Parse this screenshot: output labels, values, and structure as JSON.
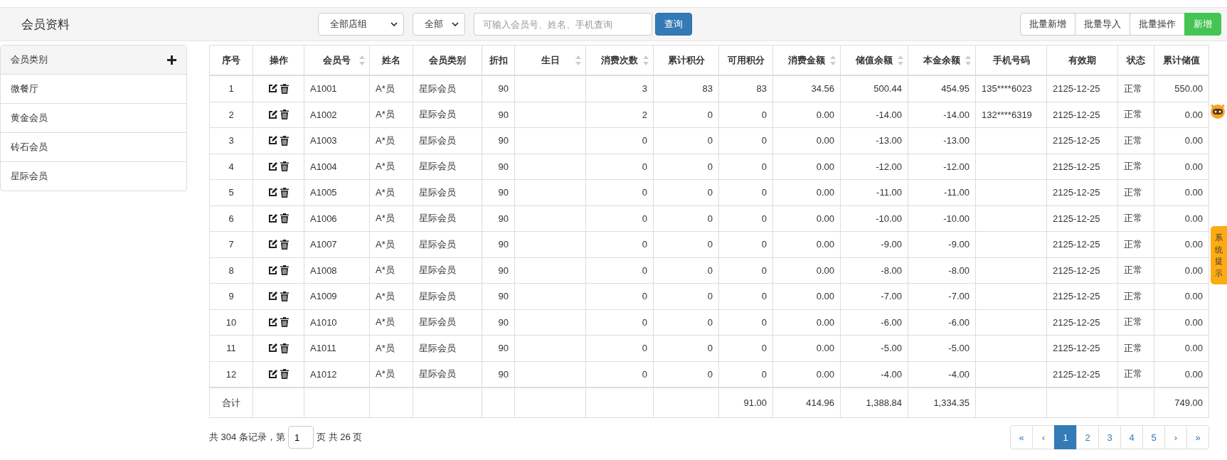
{
  "header": {
    "title": "会员资料",
    "store_group_select": "全部店组",
    "scope_select": "全部",
    "search": {
      "placeholder": "可输入会员号、姓名、手机查询"
    },
    "query_button": "查询",
    "actions": [
      {
        "label": "批量新增",
        "kind": "plain"
      },
      {
        "label": "批量导入",
        "kind": "plain"
      },
      {
        "label": "批量操作",
        "kind": "plain"
      },
      {
        "label": "新增",
        "kind": "primary"
      }
    ]
  },
  "sidebar": {
    "title": "会员类别",
    "items": [
      {
        "label": "微餐厅",
        "selected": false
      },
      {
        "label": "黄金会员",
        "selected": false
      },
      {
        "label": "砖石会员",
        "selected": false
      },
      {
        "label": "星际会员",
        "selected": false
      }
    ]
  },
  "table": {
    "columns": [
      {
        "label": "序号",
        "sortable": false
      },
      {
        "label": "操作",
        "sortable": false
      },
      {
        "label": "会员号",
        "sortable": true
      },
      {
        "label": "姓名",
        "sortable": false
      },
      {
        "label": "会员类别",
        "sortable": false
      },
      {
        "label": "折扣",
        "sortable": false
      },
      {
        "label": "生日",
        "sortable": true
      },
      {
        "label": "消费次数",
        "sortable": true
      },
      {
        "label": "累计积分",
        "sortable": false
      },
      {
        "label": "可用积分",
        "sortable": false
      },
      {
        "label": "消费金额",
        "sortable": true
      },
      {
        "label": "储值余额",
        "sortable": true
      },
      {
        "label": "本金余额",
        "sortable": true
      },
      {
        "label": "手机号码",
        "sortable": false
      },
      {
        "label": "有效期",
        "sortable": false
      },
      {
        "label": "状态",
        "sortable": false
      },
      {
        "label": "累计储值",
        "sortable": false
      }
    ],
    "rows": [
      {
        "no": "1",
        "member_no": "A1001",
        "name": "A*员",
        "category": "星际会员",
        "discount": "90",
        "visits": "3",
        "points_total": "83",
        "points_avail": "83",
        "spend": "34.56",
        "stored": "500.44",
        "principal": "454.95",
        "phone": "135****6023",
        "expiry": "2125-12-25",
        "status": "正常",
        "total_stored": "550.00"
      },
      {
        "no": "2",
        "member_no": "A1002",
        "name": "A*员",
        "category": "星际会员",
        "discount": "90",
        "visits": "2",
        "points_total": "0",
        "points_avail": "0",
        "spend": "0.00",
        "stored": "-14.00",
        "principal": "-14.00",
        "phone": "132****6319",
        "expiry": "2125-12-25",
        "status": "正常",
        "total_stored": "0.00"
      },
      {
        "no": "3",
        "member_no": "A1003",
        "name": "A*员",
        "category": "星际会员",
        "discount": "90",
        "visits": "0",
        "points_total": "0",
        "points_avail": "0",
        "spend": "0.00",
        "stored": "-13.00",
        "principal": "-13.00",
        "expiry": "2125-12-25",
        "status": "正常",
        "total_stored": "0.00"
      },
      {
        "no": "4",
        "member_no": "A1004",
        "name": "A*员",
        "category": "星际会员",
        "discount": "90",
        "visits": "0",
        "points_total": "0",
        "points_avail": "0",
        "spend": "0.00",
        "stored": "-12.00",
        "principal": "-12.00",
        "expiry": "2125-12-25",
        "status": "正常",
        "total_stored": "0.00"
      },
      {
        "no": "5",
        "member_no": "A1005",
        "name": "A*员",
        "category": "星际会员",
        "discount": "90",
        "visits": "0",
        "points_total": "0",
        "points_avail": "0",
        "spend": "0.00",
        "stored": "-11.00",
        "principal": "-11.00",
        "expiry": "2125-12-25",
        "status": "正常",
        "total_stored": "0.00"
      },
      {
        "no": "6",
        "member_no": "A1006",
        "name": "A*员",
        "category": "星际会员",
        "discount": "90",
        "visits": "0",
        "points_total": "0",
        "points_avail": "0",
        "spend": "0.00",
        "stored": "-10.00",
        "principal": "-10.00",
        "expiry": "2125-12-25",
        "status": "正常",
        "total_stored": "0.00"
      },
      {
        "no": "7",
        "member_no": "A1007",
        "name": "A*员",
        "category": "星际会员",
        "discount": "90",
        "visits": "0",
        "points_total": "0",
        "points_avail": "0",
        "spend": "0.00",
        "stored": "-9.00",
        "principal": "-9.00",
        "expiry": "2125-12-25",
        "status": "正常",
        "total_stored": "0.00"
      },
      {
        "no": "8",
        "member_no": "A1008",
        "name": "A*员",
        "category": "星际会员",
        "discount": "90",
        "visits": "0",
        "points_total": "0",
        "points_avail": "0",
        "spend": "0.00",
        "stored": "-8.00",
        "principal": "-8.00",
        "expiry": "2125-12-25",
        "status": "正常",
        "total_stored": "0.00"
      },
      {
        "no": "9",
        "member_no": "A1009",
        "name": "A*员",
        "category": "星际会员",
        "discount": "90",
        "visits": "0",
        "points_total": "0",
        "points_avail": "0",
        "spend": "0.00",
        "stored": "-7.00",
        "principal": "-7.00",
        "expiry": "2125-12-25",
        "status": "正常",
        "total_stored": "0.00"
      },
      {
        "no": "10",
        "member_no": "A1010",
        "name": "A*员",
        "category": "星际会员",
        "discount": "90",
        "visits": "0",
        "points_total": "0",
        "points_avail": "0",
        "spend": "0.00",
        "stored": "-6.00",
        "principal": "-6.00",
        "expiry": "2125-12-25",
        "status": "正常",
        "total_stored": "0.00"
      },
      {
        "no": "11",
        "member_no": "A1011",
        "name": "A*员",
        "category": "星际会员",
        "discount": "90",
        "visits": "0",
        "points_total": "0",
        "points_avail": "0",
        "spend": "0.00",
        "stored": "-5.00",
        "principal": "-5.00",
        "expiry": "2125-12-25",
        "status": "正常",
        "total_stored": "0.00"
      },
      {
        "no": "12",
        "member_no": "A1012",
        "name": "A*员",
        "category": "星际会员",
        "discount": "90",
        "visits": "0",
        "points_total": "0",
        "points_avail": "0",
        "spend": "0.00",
        "stored": "-4.00",
        "principal": "-4.00",
        "expiry": "2125-12-25",
        "status": "正常",
        "total_stored": "0.00"
      }
    ],
    "footer": {
      "no": "合计",
      "points_avail": "91.00",
      "spend": "414.96",
      "stored": "1,388.84",
      "principal": "1,334.35",
      "total_stored": "749.00"
    }
  },
  "pager": {
    "summary_before": "共 304 条记录，第",
    "page_input": "1",
    "summary_after": "页 共 26 页",
    "pages": [
      {
        "label": "«",
        "selected": false
      },
      {
        "label": "‹",
        "selected": false
      },
      {
        "label": "1",
        "selected": true
      },
      {
        "label": "2",
        "selected": false
      },
      {
        "label": "3",
        "selected": false
      },
      {
        "label": "4",
        "selected": false
      },
      {
        "label": "5",
        "selected": false
      },
      {
        "label": "›",
        "selected": false
      },
      {
        "label": "»",
        "selected": false
      }
    ]
  },
  "side_tab": "系统提示"
}
